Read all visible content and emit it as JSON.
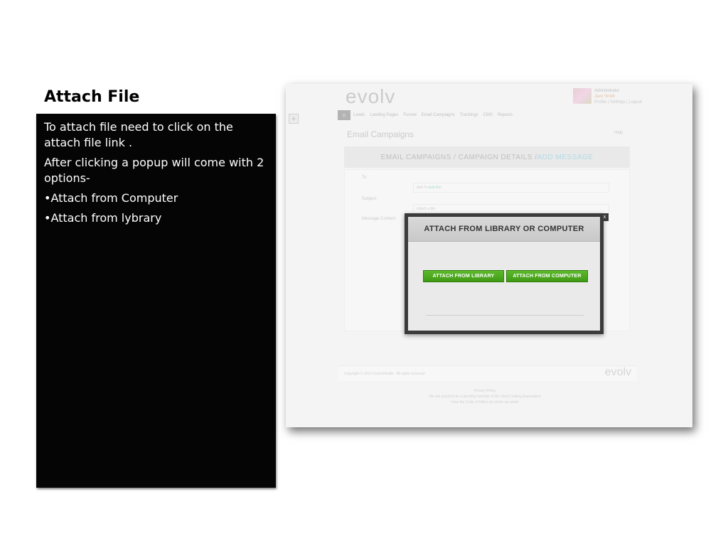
{
  "slide": {
    "title": "Attach File",
    "paragraphs": [
      "To attach file need to click on the attach file link .",
      "After clicking a popup will come with 2 options-"
    ],
    "bullets": [
      "•Attach from Computer",
      "•Attach from lybrary"
    ]
  },
  "screenshot": {
    "logo": "evolv",
    "admin": {
      "role": "Administrator",
      "user": "Jack Smith",
      "links": "Profile | Settings | Logout"
    },
    "nav_items": [
      "Leads",
      "Landing Pages",
      "Funnel",
      "Email Campaigns",
      "Trackings",
      "CMS",
      "Reports"
    ],
    "page_title": "Email Campaigns",
    "help": "Help",
    "breadcrumb": {
      "prefix": "EMAIL CAMPAIGNS / CAMPAIGN DETAILS / ",
      "current": "ADD MESSAGE"
    },
    "form": {
      "to_label": "To :",
      "to_value_prefix": "Add To",
      "to_value_link": "Add Rec",
      "subject_label": "Subject :",
      "subject_value": "Attach a file",
      "content_label": "Message Content :"
    },
    "footer": {
      "copyright": "Copyright © 2013 CrownHealth - All rights reserved",
      "logo": "evolv",
      "privacy": "Privacy Policy",
      "line2": "We are proud to be a pending member of the Direct Selling Association",
      "line3": "View the Code of Ethics by which we abide"
    },
    "modal": {
      "title": "ATTACH FROM LIBRARY OR COMPUTER",
      "close": "x",
      "btn_library": "ATTACH FROM LIBRARY",
      "btn_computer": "ATTACH FROM COMPUTER"
    }
  },
  "colors": {
    "panel_bg": "#050505",
    "button_green": "#4aa81c",
    "breadcrumb_accent": "#2aa8c8",
    "modal_border": "#3b3b3b"
  }
}
